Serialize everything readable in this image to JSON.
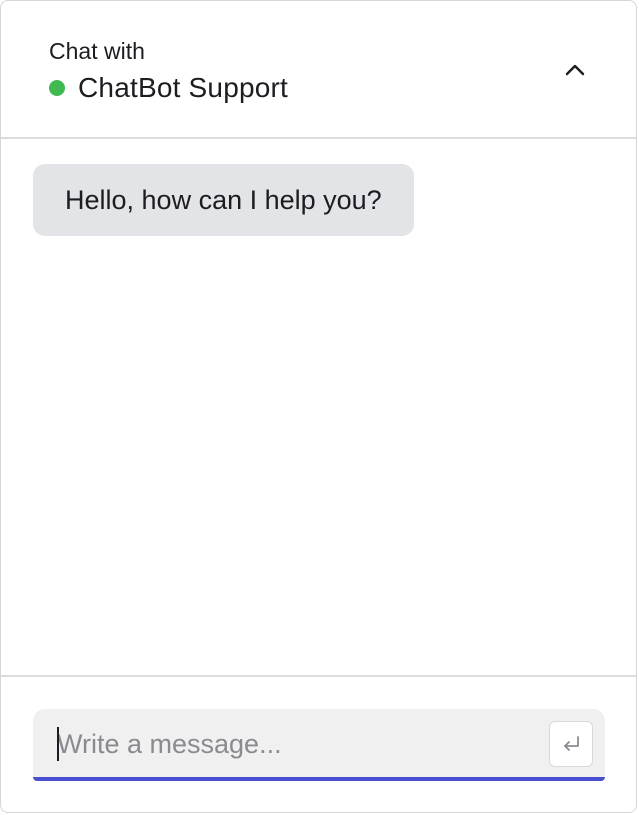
{
  "header": {
    "subtitle": "Chat with",
    "agent_name": "ChatBot Support",
    "status": "online",
    "status_color": "#3fb950",
    "collapse_icon": "chevron-up-icon"
  },
  "messages": [
    {
      "from": "bot",
      "text": "Hello, how can I help you?"
    }
  ],
  "composer": {
    "value": "",
    "placeholder": "Write a message...",
    "accent_color": "#4a4fd1",
    "send_icon": "enter-return-icon"
  }
}
